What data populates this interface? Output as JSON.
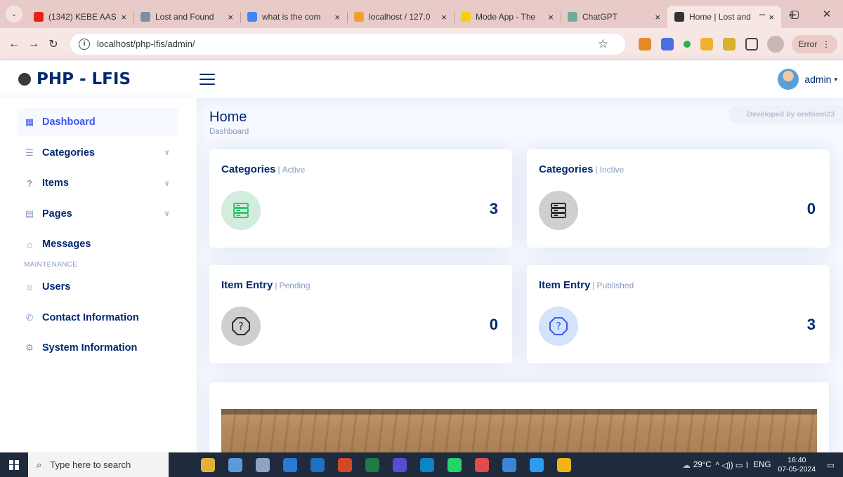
{
  "browser": {
    "tabs": [
      {
        "title": "(1342) KEBE AAS",
        "favicon_color": "#e62117",
        "active": false
      },
      {
        "title": "Lost and Found",
        "favicon_color": "#7b8fa8",
        "active": false
      },
      {
        "title": "what is the com",
        "favicon_color": "#4285f4",
        "active": false
      },
      {
        "title": "localhost / 127.0",
        "favicon_color": "#f0a030",
        "active": false
      },
      {
        "title": "Mode App - The",
        "favicon_color": "#f5d10c",
        "active": false
      },
      {
        "title": "ChatGPT",
        "favicon_color": "#74aa9c",
        "active": false
      },
      {
        "title": "Home | Lost and",
        "favicon_color": "#333333",
        "active": true
      }
    ],
    "url": "localhost/php-lfis/admin/",
    "error_label": "Error",
    "close_glyph": "×",
    "new_tab_glyph": "+",
    "window_controls": [
      "–",
      "▢",
      "✕"
    ]
  },
  "header": {
    "brand": "PHP - LFIS",
    "username": "admin",
    "caret": "▾"
  },
  "sidebar": {
    "items": [
      {
        "label": "Dashboard",
        "icon": "grid-icon",
        "glyph": "▦",
        "active": true,
        "has_submenu": false
      },
      {
        "label": "Categories",
        "icon": "list-icon",
        "glyph": "☰",
        "active": false,
        "has_submenu": true
      },
      {
        "label": "Items",
        "icon": "question-circle-icon",
        "glyph": "?",
        "active": false,
        "has_submenu": true
      },
      {
        "label": "Pages",
        "icon": "layout-icon",
        "glyph": "▤",
        "active": false,
        "has_submenu": true
      },
      {
        "label": "Messages",
        "icon": "inbox-icon",
        "glyph": "⌂",
        "active": false,
        "has_submenu": false
      }
    ],
    "maintenance_heading": "MAINTENANCE",
    "maintenance_items": [
      {
        "label": "Users",
        "icon": "people-icon",
        "glyph": "☺"
      },
      {
        "label": "Contact Information",
        "icon": "phone-icon",
        "glyph": "✆"
      },
      {
        "label": "System Information",
        "icon": "gear-icon",
        "glyph": "⚙"
      }
    ]
  },
  "page": {
    "title": "Home",
    "breadcrumb": "Dashboard",
    "developer_tag": "Developed by oretnom23"
  },
  "cards": [
    {
      "title": "Categories",
      "subtitle": "Active",
      "count": "3",
      "icon": "server-icon",
      "circle_bg": "#d2ecdd",
      "icon_color": "#2eca6a"
    },
    {
      "title": "Categories",
      "subtitle": "Inctive",
      "count": "0",
      "icon": "server-icon",
      "circle_bg": "#cfcfcf",
      "icon_color": "#2b2b2b"
    },
    {
      "title": "Item Entry",
      "subtitle": "Pending",
      "count": "0",
      "icon": "question-octagon-icon",
      "circle_bg": "#cfcfcf",
      "icon_color": "#2b2b2b"
    },
    {
      "title": "Item Entry",
      "subtitle": "Published",
      "count": "3",
      "icon": "question-octagon-icon",
      "circle_bg": "#d3e3fb",
      "icon_color": "#4154f1"
    }
  ],
  "taskbar": {
    "search_placeholder": "Type here to search",
    "apps": [
      "#e3b23c",
      "#5a9bd8",
      "#8fa4c4",
      "#2b79d6",
      "#1f6fc3",
      "#d24726",
      "#1d7b44",
      "#5b4bd1",
      "#0a84c6",
      "#25d366",
      "#e14b4b",
      "#3a86d4",
      "#2c9cf0",
      "#f2b318"
    ],
    "weather": "29°C",
    "tray_symbols": "^ ◁)) ▭ ⌇",
    "language": "ENG",
    "time": "16:40",
    "date": "07-05-2024"
  }
}
